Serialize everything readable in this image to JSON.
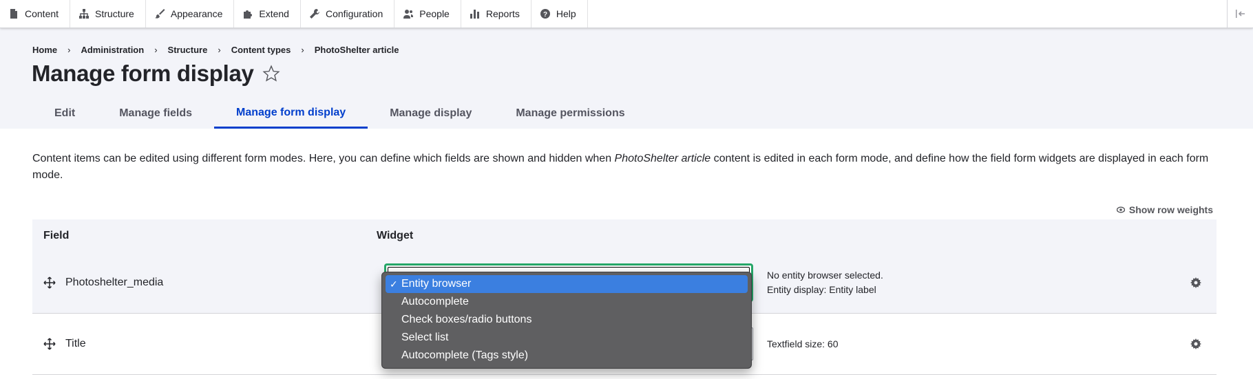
{
  "toolbar": {
    "items": [
      {
        "label": "Content",
        "icon": "file-icon"
      },
      {
        "label": "Structure",
        "icon": "sitemap-icon"
      },
      {
        "label": "Appearance",
        "icon": "brush-icon"
      },
      {
        "label": "Extend",
        "icon": "puzzle-icon"
      },
      {
        "label": "Configuration",
        "icon": "wrench-icon"
      },
      {
        "label": "People",
        "icon": "people-icon"
      },
      {
        "label": "Reports",
        "icon": "bar-chart-icon"
      },
      {
        "label": "Help",
        "icon": "help-icon"
      }
    ]
  },
  "breadcrumb": [
    "Home",
    "Administration",
    "Structure",
    "Content types",
    "PhotoShelter article"
  ],
  "page": {
    "title": "Manage form display",
    "description_pre": "Content items can be edited using different form modes. Here, you can define which fields are shown and hidden when ",
    "description_em": "PhotoShelter article",
    "description_post": " content is edited in each form mode, and define how the field form widgets are displayed in each form mode.",
    "row_weights_label": "Show row weights"
  },
  "tabs": [
    {
      "label": "Edit",
      "active": false
    },
    {
      "label": "Manage fields",
      "active": false
    },
    {
      "label": "Manage form display",
      "active": true
    },
    {
      "label": "Manage display",
      "active": false
    },
    {
      "label": "Manage permissions",
      "active": false
    }
  ],
  "table": {
    "headers": {
      "field": "Field",
      "widget": "Widget"
    },
    "rows": [
      {
        "field": "Photoshelter_media",
        "summary": [
          "No entity browser selected.",
          "Entity display: Entity label"
        ]
      },
      {
        "field": "Title",
        "summary": [
          "Textfield size: 60"
        ]
      }
    ]
  },
  "dropdown": {
    "selected": "Entity browser",
    "options": [
      "Entity browser",
      "Autocomplete",
      "Check boxes/radio buttons",
      "Select list",
      "Autocomplete (Tags style)"
    ]
  },
  "colors": {
    "accent": "#003ecc",
    "focus": "#26a769",
    "menu_bg": "#5f5f61",
    "menu_highlight": "#3b7fe0"
  }
}
